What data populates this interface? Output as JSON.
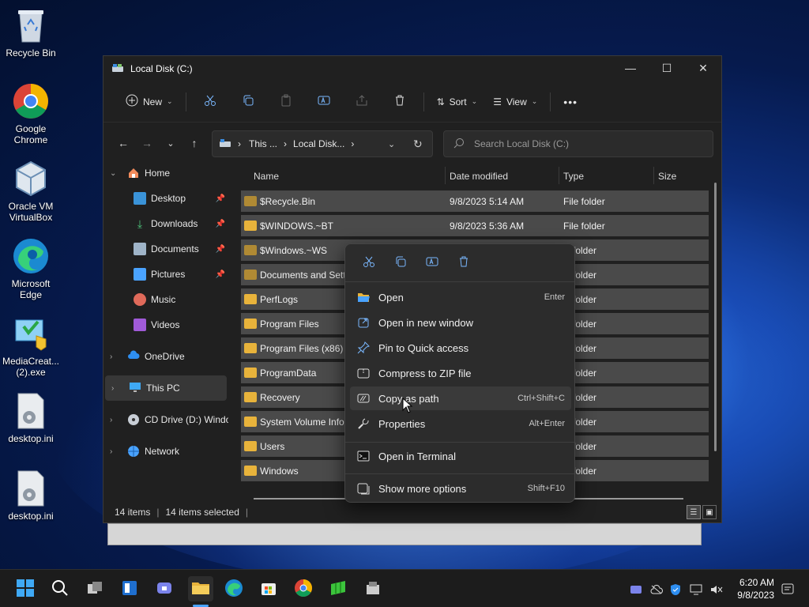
{
  "desktop": {
    "icons": [
      {
        "label": "Recycle Bin"
      },
      {
        "label": "Google Chrome"
      },
      {
        "label": "Oracle VM VirtualBox"
      },
      {
        "label": "Microsoft Edge"
      },
      {
        "label": "MediaCreat... (2).exe"
      },
      {
        "label": "desktop.ini"
      },
      {
        "label": "desktop.ini"
      }
    ]
  },
  "window": {
    "title": "Local Disk (C:)",
    "toolbar": {
      "new_label": "New",
      "sort_label": "Sort",
      "view_label": "View",
      "more_label": "•••"
    },
    "address": {
      "seg1": "This ...",
      "seg2": "Local Disk...",
      "sep": "›"
    },
    "search_placeholder": "Search Local Disk (C:)",
    "sidebar": [
      {
        "label": "Home"
      },
      {
        "label": "Desktop"
      },
      {
        "label": "Downloads"
      },
      {
        "label": "Documents"
      },
      {
        "label": "Pictures"
      },
      {
        "label": "Music"
      },
      {
        "label": "Videos"
      },
      {
        "label": "OneDrive"
      },
      {
        "label": "This PC"
      },
      {
        "label": "CD Drive (D:) Windo"
      },
      {
        "label": "Network"
      }
    ],
    "columns": {
      "name": "Name",
      "date": "Date modified",
      "type": "Type",
      "size": "Size"
    },
    "files": [
      {
        "name": "$Recycle.Bin",
        "date": "9/8/2023 5:14 AM",
        "type": "File folder"
      },
      {
        "name": "$WINDOWS.~BT",
        "date": "9/8/2023 5:36 AM",
        "type": "File folder"
      },
      {
        "name": "$Windows.~WS",
        "date": "",
        "type": "folder"
      },
      {
        "name": "Documents and Setti",
        "date": "",
        "type": "folder"
      },
      {
        "name": "PerfLogs",
        "date": "",
        "type": "folder"
      },
      {
        "name": "Program Files",
        "date": "",
        "type": "folder"
      },
      {
        "name": "Program Files (x86)",
        "date": "",
        "type": "folder"
      },
      {
        "name": "ProgramData",
        "date": "",
        "type": "folder"
      },
      {
        "name": "Recovery",
        "date": "",
        "type": "folder"
      },
      {
        "name": "System Volume Infor",
        "date": "",
        "type": "folder"
      },
      {
        "name": "Users",
        "date": "",
        "type": "folder"
      },
      {
        "name": "Windows",
        "date": "",
        "type": "folder"
      }
    ],
    "status": {
      "items": "14 items",
      "selected": "14 items selected"
    }
  },
  "context_menu": {
    "items": [
      {
        "label": "Open",
        "shortcut": "Enter"
      },
      {
        "label": "Open in new window",
        "shortcut": ""
      },
      {
        "label": "Pin to Quick access",
        "shortcut": ""
      },
      {
        "label": "Compress to ZIP file",
        "shortcut": ""
      },
      {
        "label": "Copy as path",
        "shortcut": "Ctrl+Shift+C"
      },
      {
        "label": "Properties",
        "shortcut": "Alt+Enter"
      },
      {
        "label": "Open in Terminal",
        "shortcut": ""
      },
      {
        "label": "Show more options",
        "shortcut": "Shift+F10"
      }
    ]
  },
  "taskbar": {
    "time": "6:20 AM",
    "date": "9/8/2023"
  },
  "colors": {
    "folder": "#e8b33b",
    "accent": "#4aa3ff",
    "window_bg": "#202020",
    "menu_bg": "#2c2c2c"
  }
}
